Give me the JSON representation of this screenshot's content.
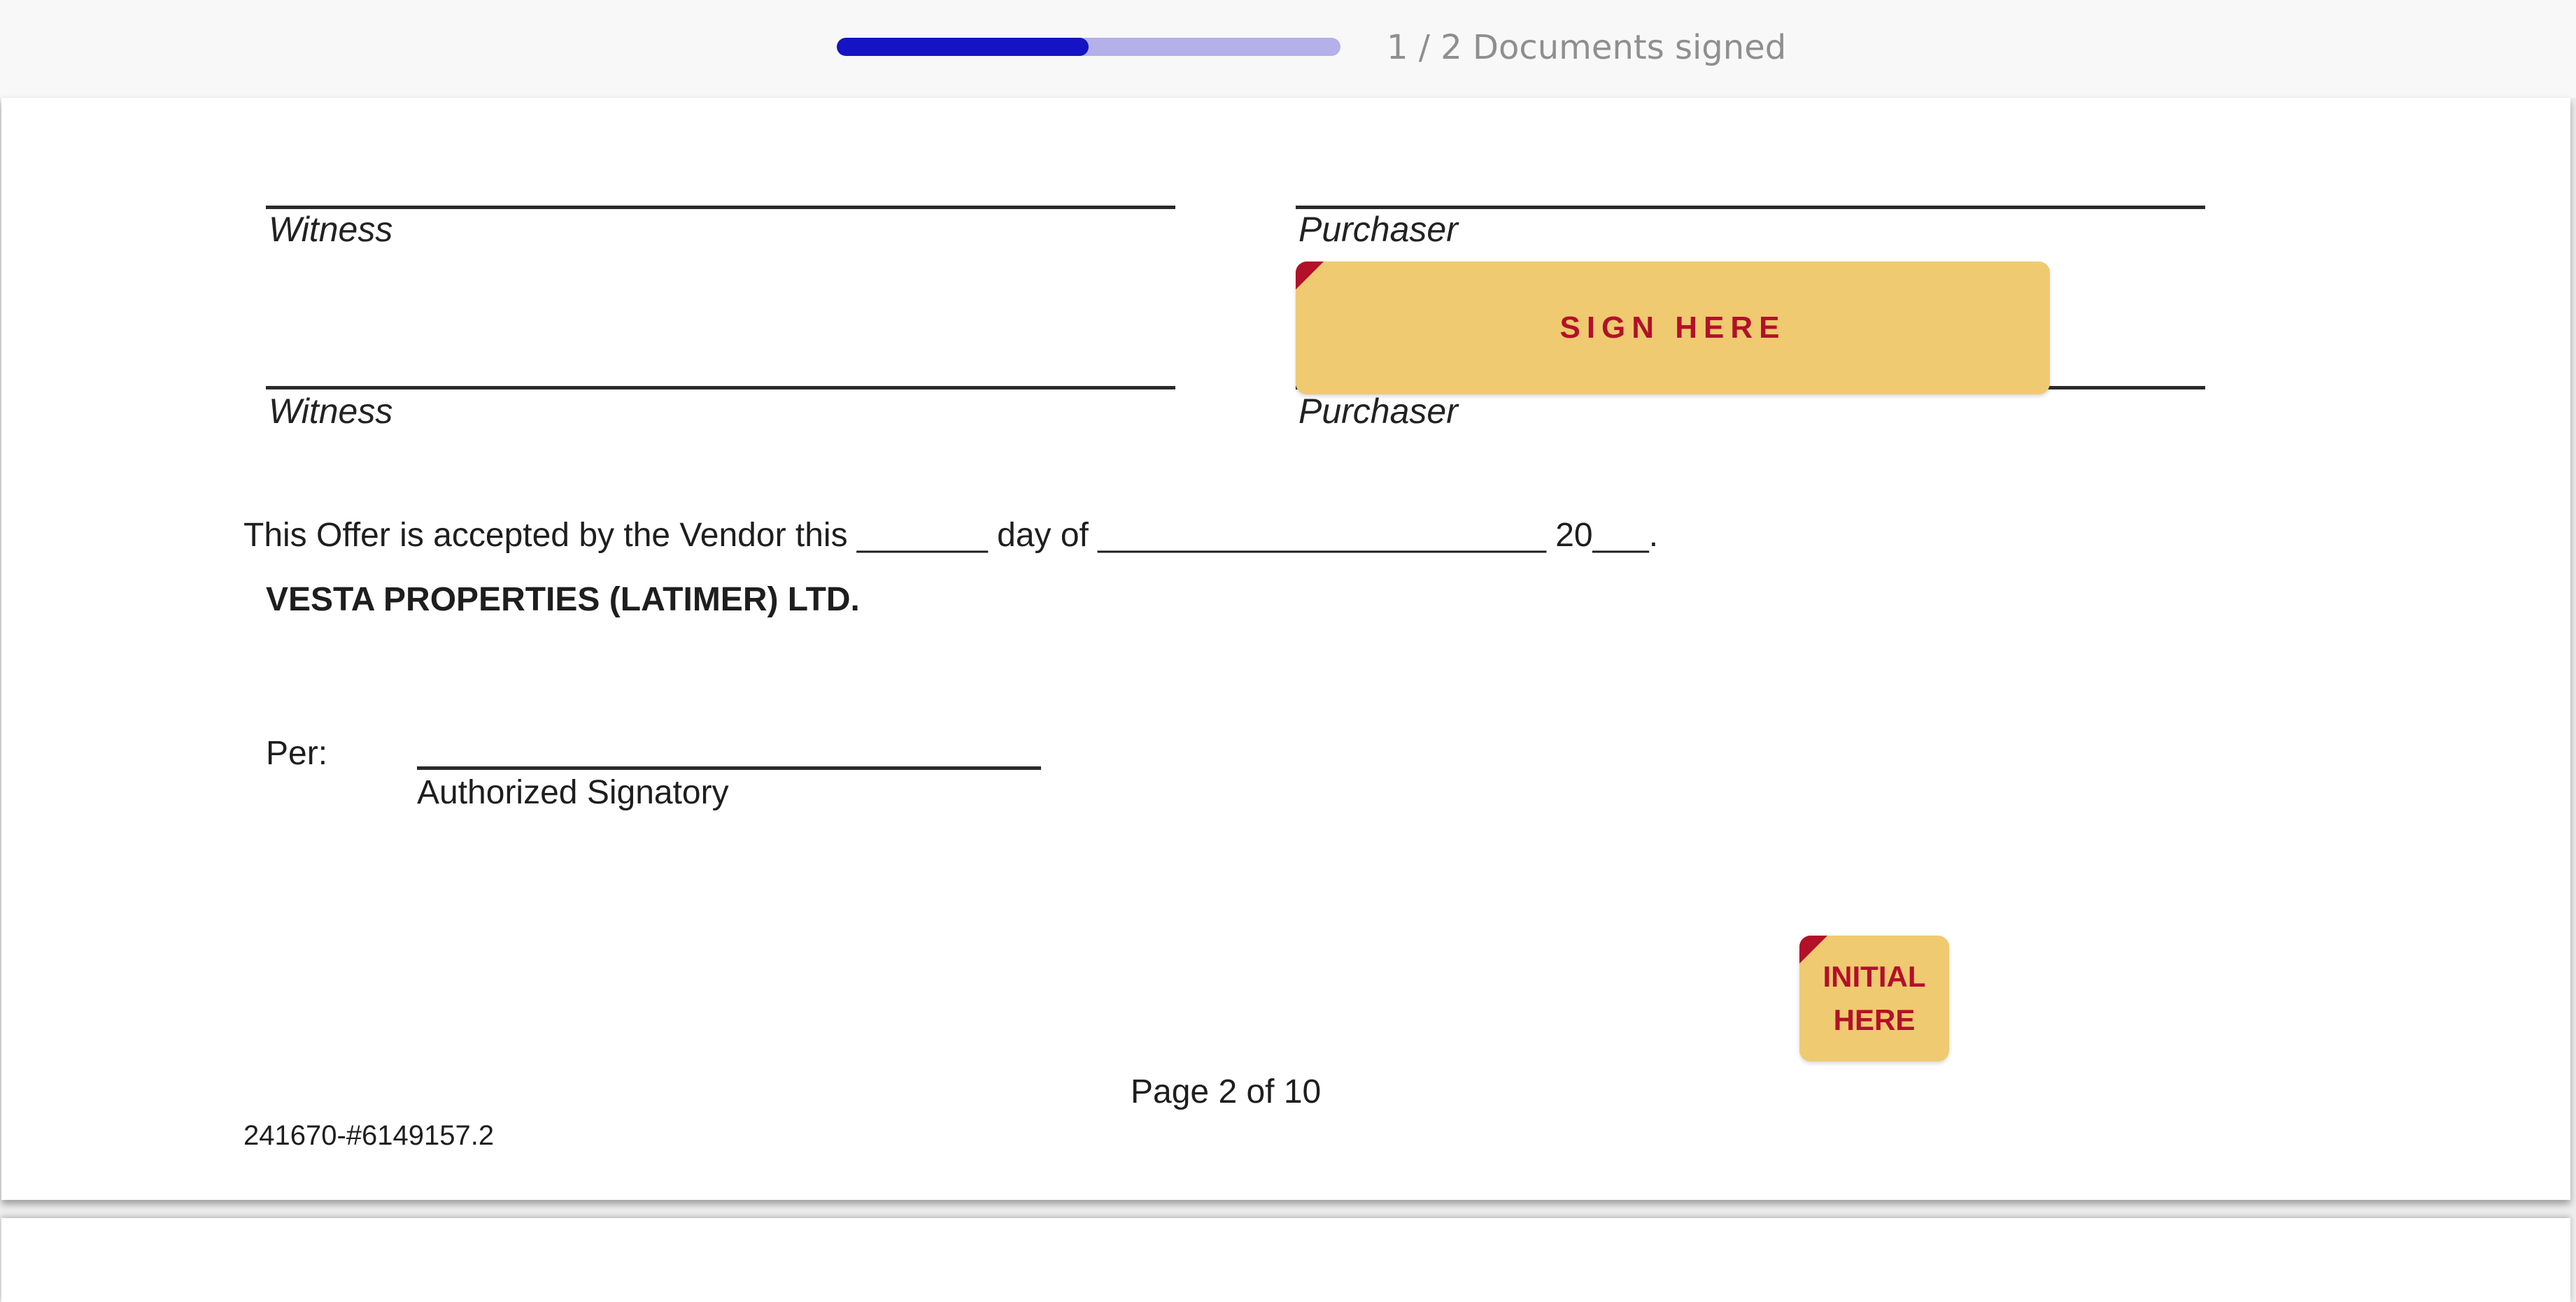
{
  "progress": {
    "signed": 1,
    "total": 2,
    "fraction": 0.5,
    "label": "1 / 2 Documents signed",
    "colors": {
      "fill": "#1414c4",
      "track": "#b4b0ea"
    }
  },
  "document": {
    "signature_block": {
      "witness_label_1": "Witness",
      "purchaser_label_1": "Purchaser",
      "witness_label_2": "Witness",
      "purchaser_label_2": "Purchaser"
    },
    "acceptance_text": "This Offer is accepted by the Vendor this _______ day of ________________________ 20___.",
    "vendor_name": "VESTA PROPERTIES (LATIMER) LTD.",
    "per_label": "Per:",
    "authorized_signatory": "Authorized Signatory",
    "page_number": "Page 2 of 10",
    "doc_id": "241670-#6149157.2"
  },
  "tags": {
    "sign_here": "SIGN HERE",
    "initial_here_line1": "INITIAL",
    "initial_here_line2": "HERE",
    "colors": {
      "background": "#efca70",
      "text": "#b3102a"
    }
  }
}
